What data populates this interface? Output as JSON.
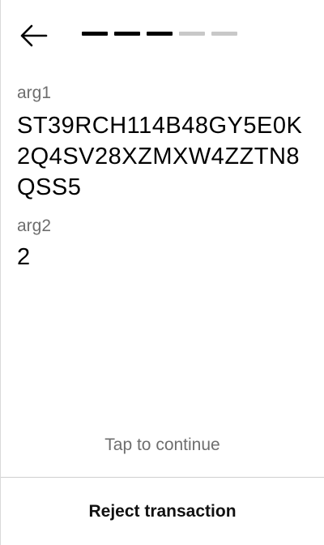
{
  "header": {
    "back_icon": "arrow-left-icon",
    "progress": {
      "total_steps": 5,
      "completed_steps": 3,
      "active_color": "#000000",
      "inactive_color": "#c8c8c8"
    }
  },
  "fields": [
    {
      "label": "arg1",
      "value": "ST39RCH114B48GY5E0K2Q4SV28XZMXW4ZZTN8QSS5"
    },
    {
      "label": "arg2",
      "value": "2"
    }
  ],
  "footer": {
    "tap_hint": "Tap to continue",
    "reject_label": "Reject transaction"
  }
}
